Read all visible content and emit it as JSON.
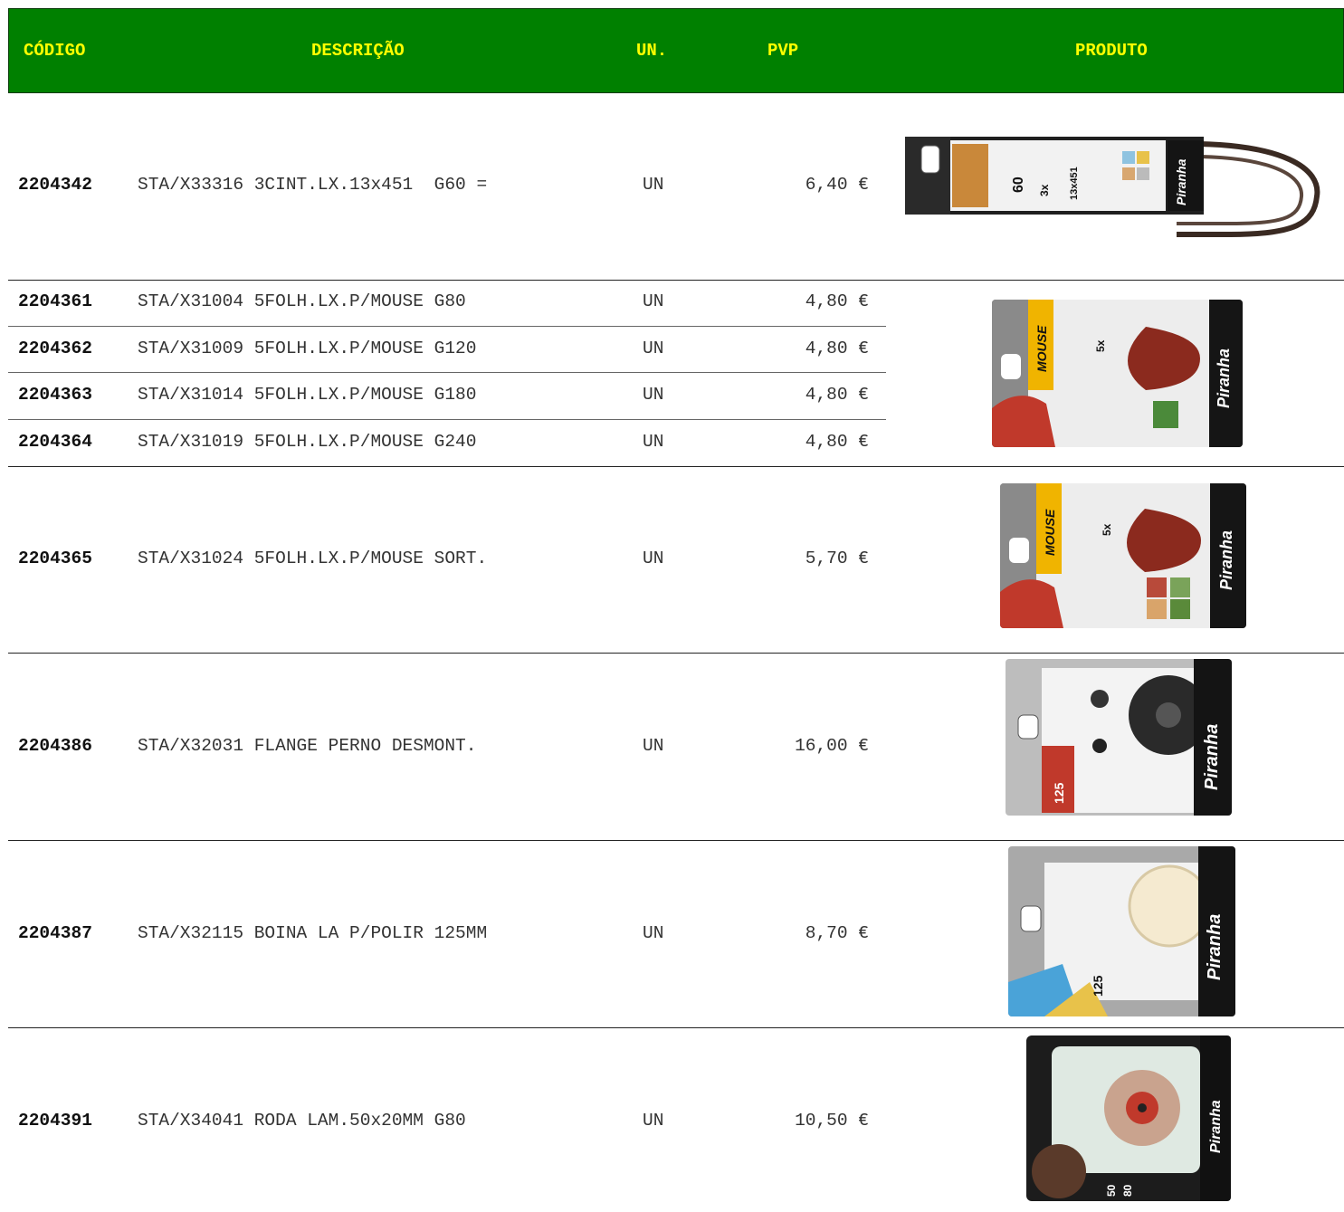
{
  "header": {
    "codigo": "CÓDIGO",
    "descricao": "DESCRIÇÃO",
    "un": "UN.",
    "pvp": "PVP",
    "produto": "PRODUTO"
  },
  "rows": [
    {
      "codigo": "2204342",
      "descricao": "STA/X33316 3CINT.LX.13x451  G60 =",
      "un": "UN",
      "pvp": "6,40 €"
    },
    {
      "codigo": "2204361",
      "descricao": "STA/X31004 5FOLH.LX.P/MOUSE G80",
      "un": "UN",
      "pvp": "4,80 €"
    },
    {
      "codigo": "2204362",
      "descricao": "STA/X31009 5FOLH.LX.P/MOUSE G120",
      "un": "UN",
      "pvp": "4,80 €"
    },
    {
      "codigo": "2204363",
      "descricao": "STA/X31014 5FOLH.LX.P/MOUSE G180",
      "un": "UN",
      "pvp": "4,80 €"
    },
    {
      "codigo": "2204364",
      "descricao": "STA/X31019 5FOLH.LX.P/MOUSE G240",
      "un": "UN",
      "pvp": "4,80 €"
    },
    {
      "codigo": "2204365",
      "descricao": "STA/X31024 5FOLH.LX.P/MOUSE SORT.",
      "un": "UN",
      "pvp": "5,70 €"
    },
    {
      "codigo": "2204386",
      "descricao": "STA/X32031 FLANGE PERNO DESMONT.",
      "un": "UN",
      "pvp": "16,00 €"
    },
    {
      "codigo": "2204387",
      "descricao": "STA/X32115 BOINA LA P/POLIR 125MM",
      "un": "UN",
      "pvp": "8,70 €"
    },
    {
      "codigo": "2204391",
      "descricao": "STA/X34041 RODA LAM.50x20MM G80",
      "un": "UN",
      "pvp": "10,50 €"
    }
  ],
  "products": {
    "belt": {
      "brand": "Piranha",
      "grit": "60",
      "qty": "3x",
      "size": "13x451"
    },
    "mouse": {
      "brand": "Piranha",
      "name": "MOUSE",
      "qty": "5x"
    },
    "mouse_sort": {
      "brand": "Piranha",
      "name": "MOUSE",
      "qty": "5x"
    },
    "flange": {
      "brand": "Piranha",
      "size": "125"
    },
    "bonnet": {
      "brand": "Piranha",
      "size": "125"
    },
    "flapwheel": {
      "brand": "Piranha",
      "size": "50",
      "grit": "80"
    }
  },
  "colors": {
    "header_bg": "#008000",
    "header_text": "#ffff00"
  }
}
